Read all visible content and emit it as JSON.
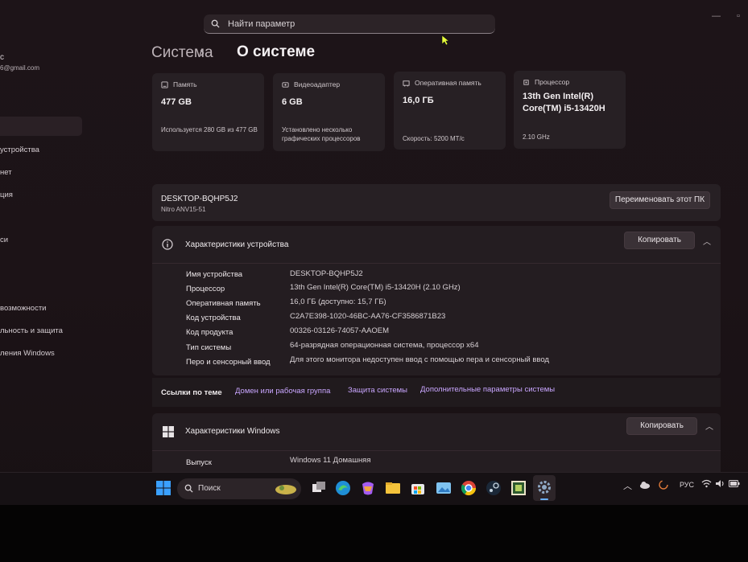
{
  "search": {
    "placeholder": "Найти параметр"
  },
  "sidebar": {
    "profile_name": "с",
    "profile_email": "6@gmail.com",
    "items": [
      {
        "label": "устройства"
      },
      {
        "label": "нет"
      },
      {
        "label": "ция"
      },
      {
        "label": "си"
      },
      {
        "label": "возможности"
      },
      {
        "label": "льность и защита"
      },
      {
        "label": "ления Windows"
      }
    ]
  },
  "header": {
    "root": "Система",
    "separator": "›",
    "current": "О системе"
  },
  "cards": [
    {
      "icon": "storage-icon",
      "title": "Память",
      "value": "477 GB",
      "sub": "Используется 280 GB из 477 GB"
    },
    {
      "icon": "display-adapter-icon",
      "title": "Видеоадаптер",
      "value": "6 GB",
      "sub": "Установлено несколько графических процессоров"
    },
    {
      "icon": "ram-icon",
      "title": "Оперативная память",
      "value": "16,0 ГБ",
      "sub": "Скорость: 5200 МТ/с"
    },
    {
      "icon": "processor-icon",
      "title": "Процессор",
      "value": "13th Gen Intel(R) Core(TM) i5-13420H",
      "sub": "2.10 GHz"
    }
  ],
  "device": {
    "name": "DESKTOP-BQHP5J2",
    "model": "Nitro ANV15-51",
    "rename_label": "Переименовать этот ПК"
  },
  "specs": {
    "title": "Характеристики устройства",
    "copy_label": "Копировать",
    "rows": [
      {
        "label": "Имя устройства",
        "value": "DESKTOP-BQHP5J2"
      },
      {
        "label": "Процессор",
        "value": "13th Gen Intel(R) Core(TM) i5-13420H (2.10 GHz)"
      },
      {
        "label": "Оперативная память",
        "value": "16,0 ГБ (доступно: 15,7 ГБ)"
      },
      {
        "label": "Код устройства",
        "value": "C2A7E398-1020-46BC-AA76-CF3586871B23"
      },
      {
        "label": "Код продукта",
        "value": "00326-03126-74057-AAOEM"
      },
      {
        "label": "Тип системы",
        "value": "64-разрядная операционная система, процессор x64"
      },
      {
        "label": "Перо и сенсорный ввод",
        "value": "Для этого монитора недоступен ввод с помощью пера и сенсорный ввод"
      }
    ]
  },
  "links": {
    "label": "Ссылки по теме",
    "items": [
      "Домен или рабочая группа",
      "Защита системы",
      "Дополнительные параметры системы"
    ]
  },
  "windows_specs": {
    "title": "Характеристики Windows",
    "copy_label": "Копировать",
    "rows": [
      {
        "label": "Выпуск",
        "value": "Windows 11 Домашняя"
      }
    ]
  },
  "taskbar": {
    "search_label": "Поиск",
    "language": "РУС"
  },
  "colors": {
    "accent": "#c9a6ff",
    "background": "#1d1418",
    "card": "#272024"
  }
}
